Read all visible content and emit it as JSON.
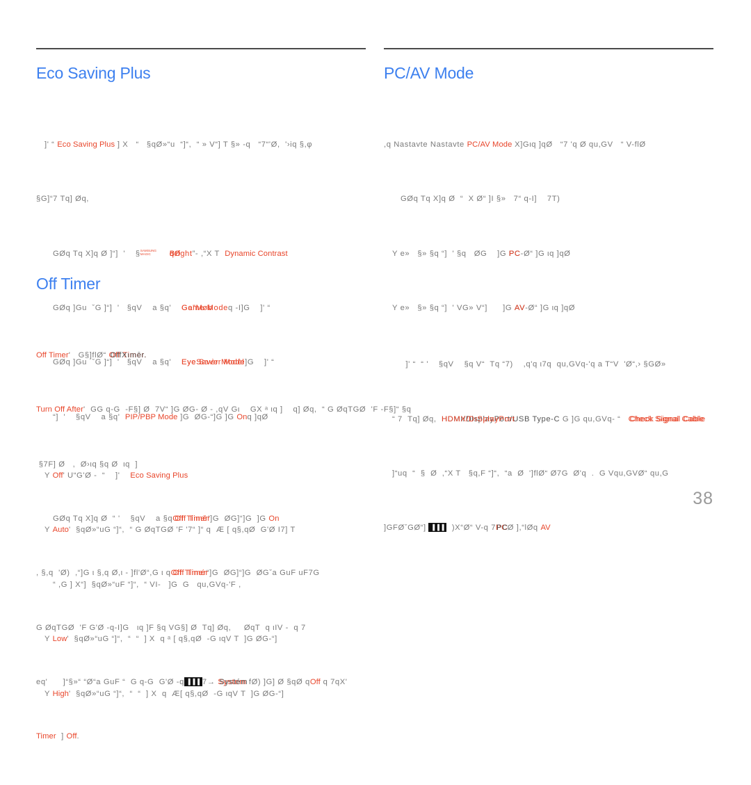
{
  "document": {
    "page_number": "38",
    "accent_blue": "#3d80ef",
    "accent_red": "#e8452a",
    "body_gray": "#7a7a7a",
    "rule_color": "#4a4a4a"
  },
  "sections": {
    "eco_saving_plus": {
      "heading": "Eco Saving Plus",
      "lines": {
        "l1_a": "]' “ ",
        "l1_red": "Eco Saving Plus",
        "l1_b": " ] X   “   §qØ»“u  “]“,  “ » V“] T §» -q   “7“'Ø,  '›iq §,φ",
        "l2": "§G]“7 Tq] Øq,",
        "l3_a": "GØq Tq X]q Ø ]“]  '    §",
        "l3_logo_top": "SAMSUNG",
        "l3_logo_bottom": "MAGIC",
        "l3_ov_a": "Bright",
        "l3_ov_b": "qØ",
        "l3_b": "”- ,“X T  ",
        "l3_red2": "Dynamic Contrast",
        "l4_a": "GØq ]Gu  ˇG ]“]  '   §qV    a §q'    ",
        "l4_ov_a": "Game Mode",
        "l4_ov_b": "Ge”Møb",
        "l4_b": "q -I]G    ]' “",
        "l5_a": "GØq ]Gu  ˇG ]“]  '   §qV    a §q'    ",
        "l5_ov_a": "Eye Saver Mode",
        "l5_ov_b": "EyeSavèr Modèl",
        "l5_b": "]G    ]' “",
        "l6_a": "“]  '    §qV    a §q'  ",
        "l6_red": "PIP/PBP Mode",
        "l6_b": " ]G  ØG-“]G ]G ",
        "l6_red2": "On",
        "l6_c": "q ]qØ",
        "l7_bullet": "Y ",
        "l7_red": "Off",
        "l7_a": "' U“G'Ø -  “    ]'    ",
        "l7_red2": "Eco Saving Plus",
        "l8_bullet": "Y ",
        "l8_red": "Auto",
        "l8_a": "'  §qØ»“uG “]“,  “ G ØqTGØ 'F '7“ ]“ q  Æ [ q§,qØ  G'Ø I7] T  ",
        "l9": "“ ,G ] X“]  §qØ»“uF “]“,  “ VI-   ]G  G   qu,GVq-'F ,",
        "l10_bullet": "Y ",
        "l10_red": "Low",
        "l10_a": "'  §qØ»“uG “]“,  “  “  ] X  q ᵃ [ q§,qØ  -G ιqV T  ]G ØG-“]",
        "l11_bullet": "Y ",
        "l11_red": "High",
        "l11_a": "'  §qØ»“uG “]“,  “  “  ] X  q  Æ[ q§,qØ  -G ιqV T  ]G ØG-“]"
      }
    },
    "pc_av_mode": {
      "heading": "PC/AV Mode",
      "lines": {
        "l1_a": ",q ",
        "l1_ov_a": "Nastavte ",
        "l1_ov_b": "Nastavte",
        "l1_red": "PC/AV Mode",
        "l1_b": " X]Gιq ]qØ   “7 'q Ø qu,GV   “ V-flØ",
        "l2": "GØq Tq X]q Ø  “  X Ø“ ]I §»   7“ q-I]    7T)",
        "l3_bullet": "Y ",
        "l3_a": "e»   §» §q “]  ' §q   ØG    ]G ",
        "l3_ov_a": "PC",
        "l3_ov_b": "PC",
        "l3_b": "-Ø“ ]G ιq ]qØ",
        "l4_bullet": "Y ",
        "l4_a": "e»   §» §q “]  ' VG» V“]      ]G ",
        "l4_ov_a": "AV",
        "l4_ov_b": "AV",
        "l4_b": "-Ø“ ]G ιq ]qØ",
        "l5": "  ]' “  “ '    §qV    §q V“  Tq “7)    ,q'q ι7q  qu,GVq-'q a T“V  'Ø“,› §GØ»",
        "l6_a": "“ 7  Tq] Øq,  ",
        "l6_ov_a": "HDMI/DisplayPort/USB Type-C",
        "l6_ov_b": "HDMX/DıSpłayPort",
        "l6_b": " G ]G qu,GVq- “   ",
        "l6_ov2_a": "Check Signal Cable",
        "l6_ov2_b": "Check Signal Cable",
        "l7": "]“uq  “  §  Ø  ,“X T   §q,F “]“,  “a  Ø  ']flØ“ Ø7G  Ø'q  .  G Vqu,GVØ“ qu,G",
        "l8_a": "]GFØˇGØ“] ",
        "l8_jog": "▐▐▐",
        "l8_b": "  )X“Ø“ V-q 7",
        "l8_ov_a": "PC",
        "l8_ov_b": "PC",
        "l8_c": "Ø ],“lØq ",
        "l8_red2": "AV"
      }
    },
    "off_timer": {
      "heading": "Off Timer",
      "lines": {
        "l1_red": "Off Timer",
        "l1_a": "'   G§]flØ“ ",
        "l1_ov_a": "Off Timer.",
        "l1_ov_b": "OffXımēr.",
        "l2_red": "Turn Off After",
        "l2_a": "'  GG q-G  -F§] Ø  7V“ ]G ØG- Ø - ,qV Gι    GX ᵃ ιq ]    q] Øq,  “ G ØqTGØ  'F -F§]“ §q",
        "l3": " §7F] Ø   ,  Ø›ιq §q Ø  ιq  ]",
        "l4_a": "GØq Tq X]q Ø  “ '    §qV    a §q",
        "l4_ov_a": "Off Timer",
        "l4_ov_b": "Off Timěr",
        "l4_b": "']G  ØG]“]G  ]G ",
        "l4_red2": "On",
        "l5_a": ", §,q  'Ø)  ,“]G ι §,q Ø,ι - ]fl'Ø“,G ι q",
        "l5_ov_a": "Off Timer",
        "l5_ov_b": "Off Timér",
        "l5_b": "“]G  ØG]“]G  ØGˇa GuF uF7G",
        "l6": "G ØqTGØ  'F G'Ø -q-I]G   ιq ]F §q VG§] Ø  Tq] Øq,     ØqT  q ιIV -  q 7",
        "l7_a": "eq'      ]“§»“ “Ø“a GuF “  G q-G  G'Ø -q",
        "l7_jog": "▐▐▐",
        "l7_b": "7→ ",
        "l7_ov_a": "System",
        "l7_ov_b": "Systém",
        "l7_c": " fØ) ]G] Ø §qØ q",
        "l7_red2": "Off",
        "l7_d": " q 7qX'",
        "l8_red": "Timer",
        "l8_a": "  ] ",
        "l8_red2": "Off",
        "l8_b": "."
      }
    }
  }
}
